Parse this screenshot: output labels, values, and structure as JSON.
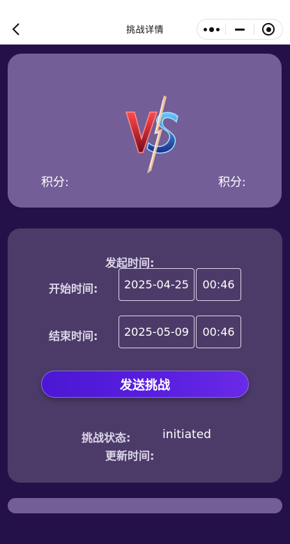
{
  "nav": {
    "title": "挑战详情",
    "icons": [
      "back-arrow-icon",
      "more-dots-icon",
      "minimize-icon",
      "close-target-icon"
    ]
  },
  "vs_card": {
    "logo_text": "VS",
    "left_score_label": "积分:",
    "right_score_label": "积分:"
  },
  "form": {
    "initiated_time_label": "发起时间:",
    "start_time_label": "开始时间:",
    "start_date": "2025-04-25",
    "start_time": "00:46",
    "end_time_label": "结束时间:",
    "end_date": "2025-05-09",
    "end_time": "00:46",
    "send_button": "发送挑战",
    "status_label": "挑战状态:",
    "status_value": "initiated",
    "updated_time_label": "更新时间:"
  },
  "colors": {
    "background": "#24114a",
    "card_vs": "#735e97",
    "card_form": "#4c3b68",
    "button": "#5a1fe0"
  }
}
